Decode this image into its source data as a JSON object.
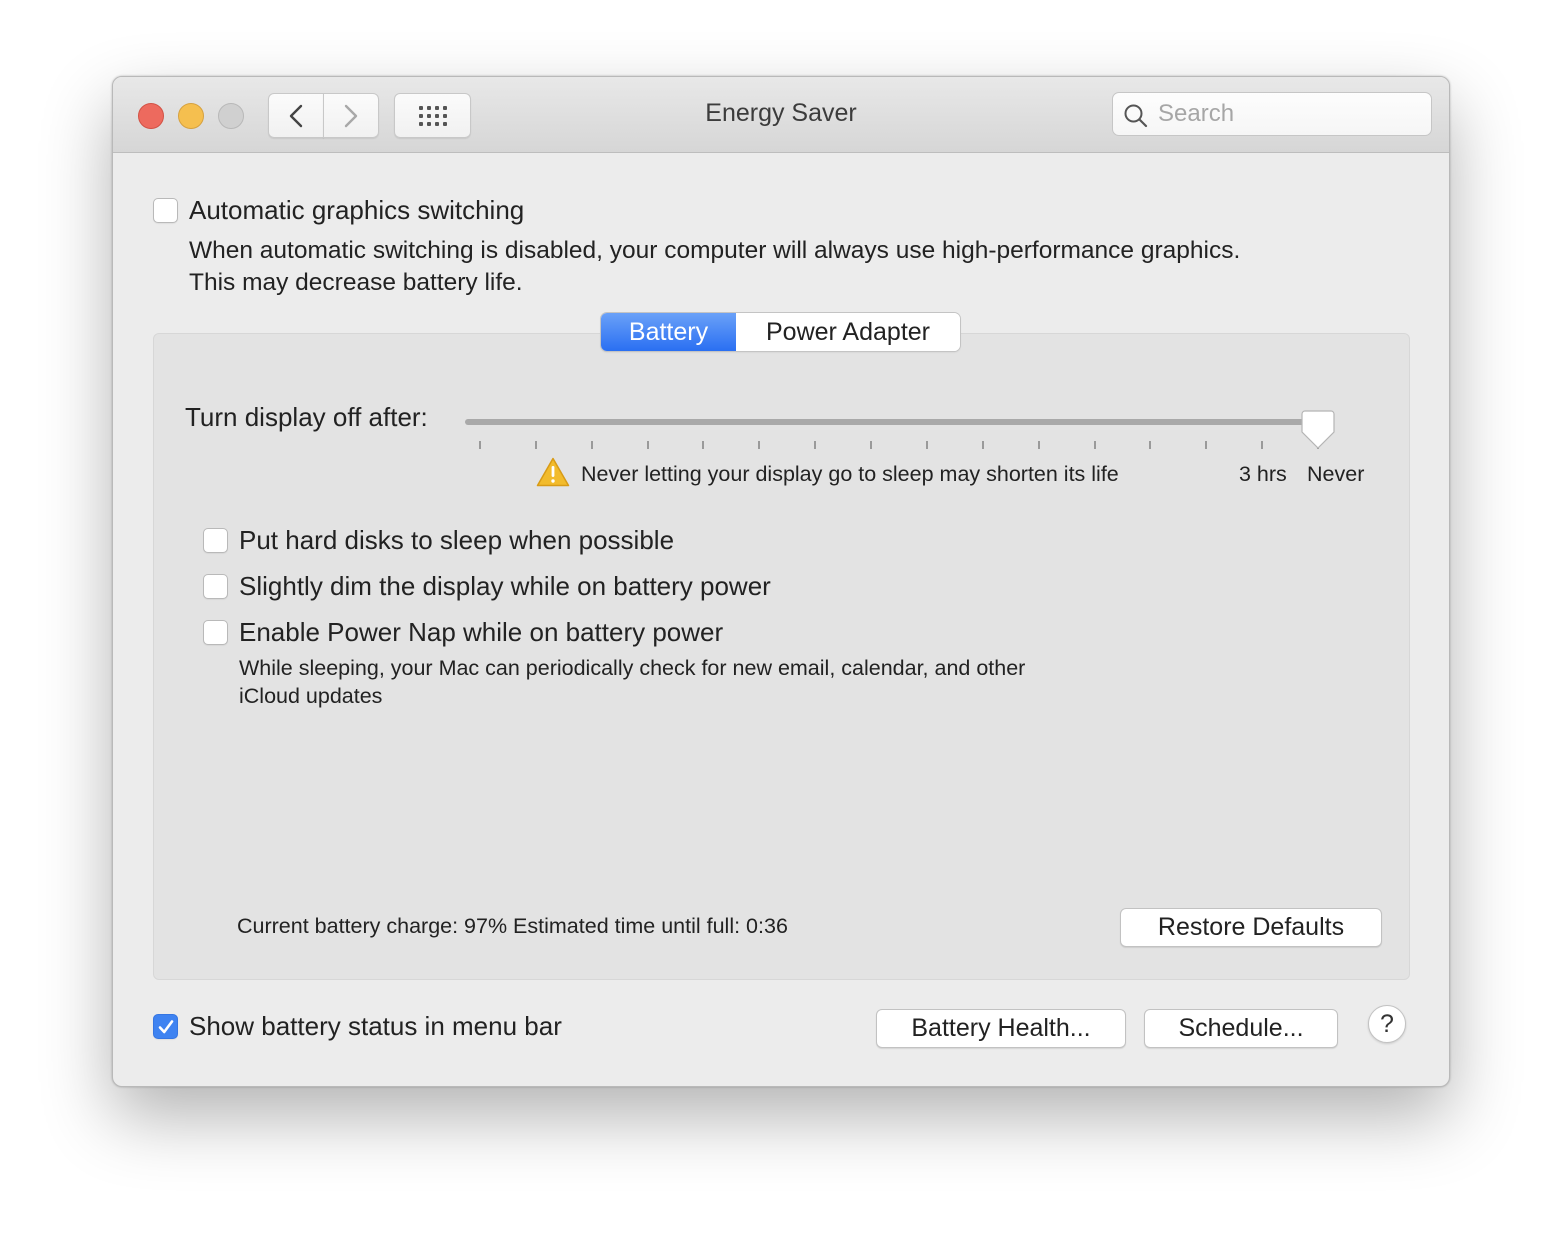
{
  "window": {
    "title": "Energy Saver",
    "search": {
      "placeholder": "Search",
      "value": ""
    }
  },
  "titlebar": {
    "traffic_lights": [
      "close",
      "minimize",
      "zoom-disabled"
    ],
    "nav": {
      "back_icon": "chevron-left-icon",
      "forward_icon": "chevron-right-icon",
      "grid_icon": "grid-icon"
    }
  },
  "graphics": {
    "label": "Automatic graphics switching",
    "checked": false,
    "description_line1": "When automatic switching is disabled, your computer will always use high-performance graphics.",
    "description_line2": "This may decrease battery life."
  },
  "tabs": [
    {
      "label": "Battery",
      "active": true
    },
    {
      "label": "Power Adapter",
      "active": false
    }
  ],
  "display_sleep": {
    "label": "Turn display off after:",
    "value": "Never",
    "position_fraction": 1.0,
    "tick_count": 16,
    "tick_labels": [
      "3 hrs",
      "Never"
    ],
    "warning": "Never letting your display go to sleep may shorten its life",
    "warning_icon": "warning-icon"
  },
  "options": [
    {
      "label": "Put hard disks to sleep when possible",
      "checked": false
    },
    {
      "label": "Slightly dim the display while on battery power",
      "checked": false
    },
    {
      "label": "Enable Power Nap while on battery power",
      "checked": false
    }
  ],
  "power_nap_description": {
    "line1": "While sleeping, your Mac can periodically check for new email, calendar, and other",
    "line2": "iCloud updates"
  },
  "battery_status": "Current battery charge: 97% Estimated time until full: 0:36",
  "buttons": {
    "restore_defaults": "Restore Defaults",
    "battery_health": "Battery Health...",
    "schedule": "Schedule...",
    "help": "?"
  },
  "show_battery_status": {
    "label": "Show battery status in menu bar",
    "checked": true
  },
  "colors": {
    "accent": "#2a6ff2",
    "checkbox_checked": "#3f83f1",
    "warning": "#f0b429"
  }
}
